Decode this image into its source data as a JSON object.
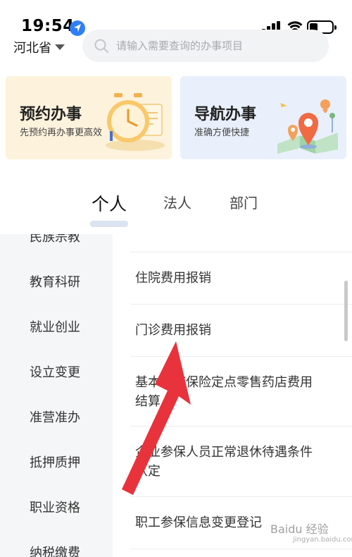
{
  "status_bar": {
    "time": "19:54"
  },
  "header": {
    "region": "河北省",
    "search_placeholder": "请输入需要查询的办事项目"
  },
  "cards": [
    {
      "title": "预约办事",
      "subtitle": "先预约再办事更高效"
    },
    {
      "title": "导航办事",
      "subtitle": "准确方便快捷"
    }
  ],
  "tabs": [
    {
      "label": "个人",
      "active": true
    },
    {
      "label": "法人",
      "active": false
    },
    {
      "label": "部门",
      "active": false
    }
  ],
  "sidebar": {
    "items": [
      {
        "label": "民族宗教"
      },
      {
        "label": "教育科研"
      },
      {
        "label": "就业创业"
      },
      {
        "label": "设立变更"
      },
      {
        "label": "准营准办"
      },
      {
        "label": "抵押质押"
      },
      {
        "label": "职业资格"
      },
      {
        "label": "纳税缴费"
      }
    ]
  },
  "services": {
    "items": [
      {
        "lines": [
          "住院费用报销"
        ]
      },
      {
        "lines": [
          "门诊费用报销"
        ]
      },
      {
        "lines": [
          "基本医疗保险定点零售药店费用",
          "结算"
        ]
      },
      {
        "lines": [
          "企业参保人员正常退休待遇条件",
          "认定"
        ]
      },
      {
        "lines": [
          "职工参保信息变更登记"
        ]
      }
    ]
  },
  "watermark": {
    "text": "Baidu 经验",
    "sub": "jingyan.baidu.com"
  },
  "colors": {
    "accent_blue": "#2f7ff6",
    "annotation_red": "#e8333c",
    "card_left_bg": "#fdf2dc",
    "card_right_bg": "#e9f0fb"
  }
}
